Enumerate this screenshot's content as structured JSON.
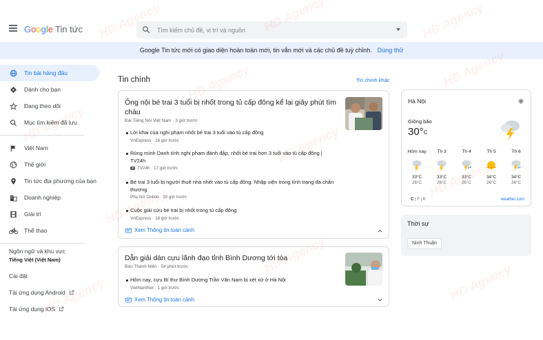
{
  "header": {
    "logo_letters": [
      "G",
      "o",
      "o",
      "g",
      "l",
      "e"
    ],
    "product": "Tin tức",
    "search_placeholder": "Tìm kiếm chủ đề, vị trí và nguồn"
  },
  "banner": {
    "text": "Google Tin tức mới có giao diện hoàn toàn mới, tin vắn mới và các chủ đề tuỳ chỉnh.",
    "link": "Dùng thử"
  },
  "sidebar": {
    "items": [
      {
        "label": "Tin bài hàng đầu",
        "icon": "globe-icon"
      },
      {
        "label": "Dành cho bạn",
        "icon": "diamond-icon"
      },
      {
        "label": "Đang theo dõi",
        "icon": "star-icon"
      },
      {
        "label": "Mục tìm kiếm đã lưu",
        "icon": "search-icon"
      },
      {
        "label": "Việt Nam",
        "icon": "flag-icon"
      },
      {
        "label": "Thế giới",
        "icon": "world-icon"
      },
      {
        "label": "Tin tức địa phương của bạn",
        "icon": "location-icon"
      },
      {
        "label": "Doanh nghiệp",
        "icon": "business-icon"
      },
      {
        "label": "Giải trí",
        "icon": "film-icon"
      },
      {
        "label": "Thể thao",
        "icon": "bike-icon"
      }
    ],
    "lang_label": "Ngôn ngữ và khu vực",
    "lang_value": "Tiếng Việt (Việt Nam)",
    "settings": "Cài đặt",
    "android": "Tải ứng dụng Android",
    "ios": "Tải ứng dụng iOS"
  },
  "main": {
    "section_title": "Tin chính",
    "section_link": "Tin chính khác",
    "card1": {
      "title": "Ông nội bé trai 3 tuổi bị nhốt trong tủ cấp đông kể lại giây phút tìm cháu",
      "source": "Đài Tiếng Nói Việt Nam",
      "time": "3 giờ trước",
      "related": [
        {
          "title": "Lời khai của nghi phạm nhốt bé trai 3 tuổi vào tủ cấp đông",
          "source": "VnExpress",
          "time": "16 giờ trước",
          "video": false
        },
        {
          "title": "Rùng mình Danh tính nghi phạm đánh đập, nhốt bé trai hơn 3 tuổi vào tủ cấp đông | TV24h",
          "source": "TV24h",
          "time": "17 giờ trước",
          "video": true
        },
        {
          "title": "Bé trai 3 tuổi bị người thuê nhà nhét vào tủ cấp đông: Nhập viện trong tình trạng đa chấn thương",
          "source": "Phụ Nữ Online",
          "time": "20 giờ trước",
          "video": false
        },
        {
          "title": "Cuộc giải cứu bé trai bị nhốt trong tủ cấp đông",
          "source": "VnExpress",
          "time": "18 giờ trước",
          "video": false
        }
      ],
      "full_coverage": "Xem Thông tin toàn cảnh"
    },
    "card2": {
      "title": "Dẫn giải dàn cựu lãnh đạo tỉnh Bình Dương tới tòa",
      "source": "Báo Thanh Niên",
      "time": "54 phút trước",
      "related": [
        {
          "title": "Hôm nay, cựu Bí thư Bình Dương Trần Văn Nam bị xét xử ở Hà Nội",
          "source": "VietNamNet",
          "time": "1 giờ trước",
          "video": false
        }
      ],
      "full_coverage": "Xem Thông tin toàn cảnh"
    }
  },
  "weather": {
    "location": "Hà Nội",
    "condition": "Giông bão",
    "temp": "30°",
    "unit": "C",
    "days": [
      {
        "label": "Hôm nay",
        "icon": "storm-icon",
        "hi": "33°C",
        "lo": "26°C"
      },
      {
        "label": "Th 3",
        "icon": "storm-icon",
        "hi": "33°C",
        "lo": "26°C"
      },
      {
        "label": "Th 4",
        "icon": "rain-storm-icon",
        "hi": "33°C",
        "lo": "26°C"
      },
      {
        "label": "Th 5",
        "icon": "sunny-icon",
        "hi": "34°C",
        "lo": "26°C"
      },
      {
        "label": "Th 6",
        "icon": "rain-storm-icon",
        "hi": "34°C",
        "lo": "26°C"
      }
    ],
    "units": [
      "C",
      "F",
      "K"
    ],
    "source": "weather.com"
  },
  "topics": {
    "title": "Thời sự",
    "chips": [
      "Ninh Thuận"
    ]
  },
  "watermark": "HD Agency",
  "colors": {
    "accent": "#1a73e8",
    "active_bg": "#e8f0fe",
    "banner_bg": "#e8f0fe",
    "storm": "#fbbc05"
  }
}
